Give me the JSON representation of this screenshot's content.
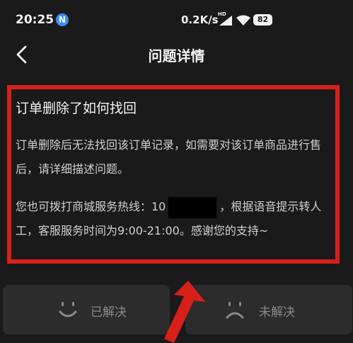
{
  "status_bar": {
    "time": "20:25",
    "app_badge": "N",
    "net_speed": "0.2K/s",
    "hd_label": "HD",
    "battery": "82"
  },
  "header": {
    "title": "问题详情"
  },
  "article": {
    "title": "订单删除了如何找回",
    "paragraph1": "订单删除后无法找回该订单记录，如需要对该订单商品进行售后，请详细描述问题。",
    "paragraph2_prefix": "您也可拨打商城服务热线：10",
    "paragraph2_suffix": "，根据语音提示转人工，客服服务时间为9:00-21:00。感谢您的支持~"
  },
  "feedback": {
    "resolved_label": "已解决",
    "unresolved_label": "未解决"
  },
  "colors": {
    "background": "#1a1a1a",
    "annotation_red": "#d8201a",
    "button_bg": "#2c2c2c"
  }
}
